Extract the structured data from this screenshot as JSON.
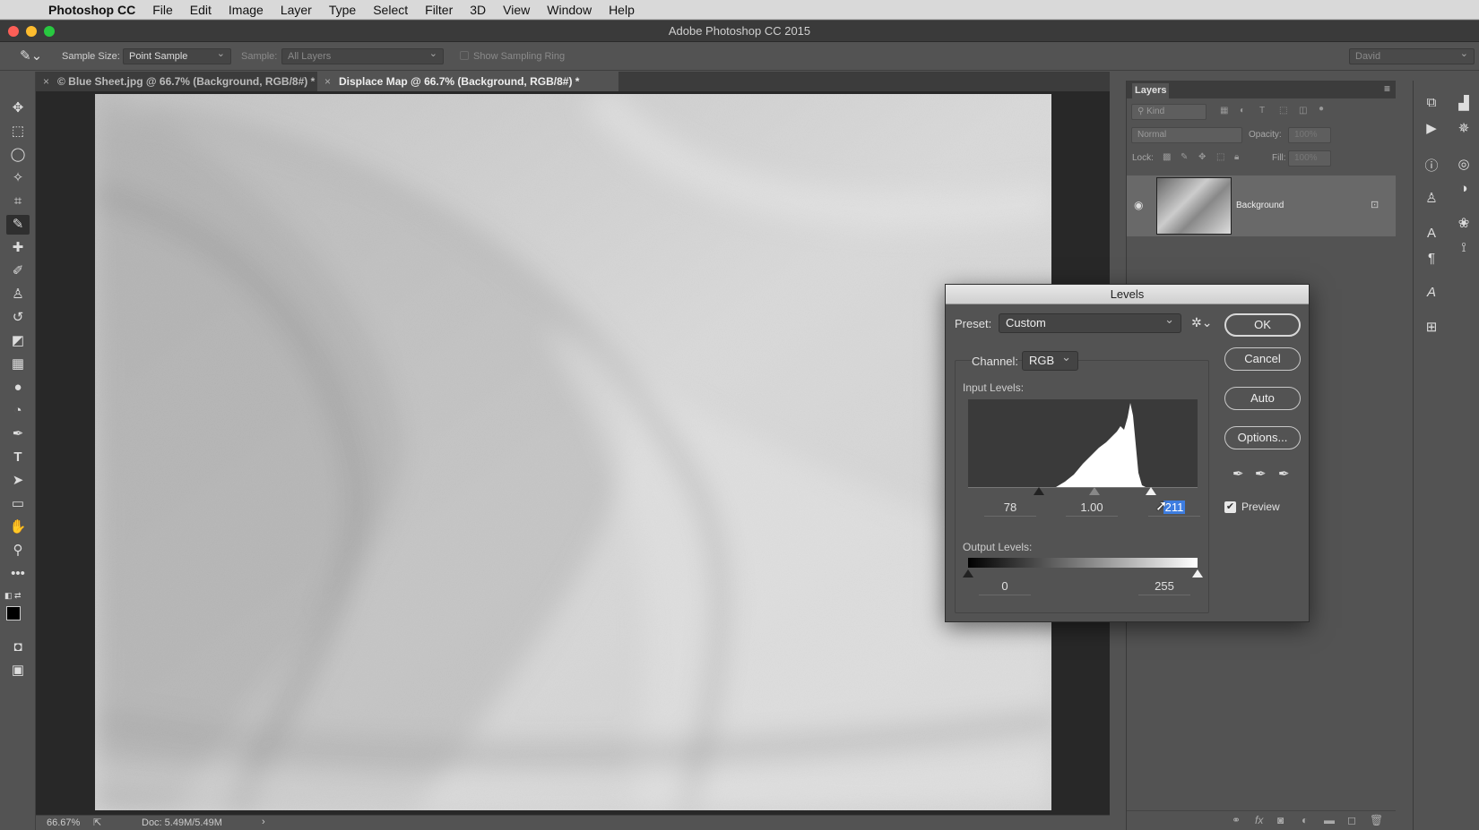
{
  "menubar": {
    "app_name": "Photoshop CC",
    "items": [
      "File",
      "Edit",
      "Image",
      "Layer",
      "Type",
      "Select",
      "Filter",
      "3D",
      "View",
      "Window",
      "Help"
    ]
  },
  "window": {
    "title": "Adobe Photoshop CC 2015"
  },
  "options_bar": {
    "sample_size_label": "Sample Size:",
    "sample_size_value": "Point Sample",
    "sample_label": "Sample:",
    "sample_value": "All Layers",
    "sampling_ring_label": "Show Sampling Ring",
    "workspace_value": "David"
  },
  "tabs": [
    {
      "label": "© Blue Sheet.jpg @ 66.7% (Background, RGB/8#) *",
      "active": false
    },
    {
      "label": "Displace Map @ 66.7% (Background, RGB/8#) *",
      "active": true
    }
  ],
  "status": {
    "zoom": "66.67%",
    "doc": "Doc: 5.49M/5.49M"
  },
  "layers_panel": {
    "title": "Layers",
    "kind_label": "Kind",
    "blend_mode": "Normal",
    "opacity_label": "Opacity:",
    "opacity_value": "100%",
    "lock_label": "Lock:",
    "fill_label": "Fill:",
    "fill_value": "100%",
    "layers": [
      {
        "name": "Background",
        "visible": true,
        "locked": true
      }
    ]
  },
  "levels_dialog": {
    "title": "Levels",
    "preset_label": "Preset:",
    "preset_value": "Custom",
    "channel_label": "Channel:",
    "channel_value": "RGB",
    "input_levels_label": "Input Levels:",
    "input_black": "78",
    "input_gamma": "1.00",
    "input_white": "211",
    "output_levels_label": "Output Levels:",
    "output_black": "0",
    "output_white": "255",
    "buttons": {
      "ok": "OK",
      "cancel": "Cancel",
      "auto": "Auto",
      "options": "Options..."
    },
    "preview_label": "Preview",
    "preview_checked": true
  }
}
